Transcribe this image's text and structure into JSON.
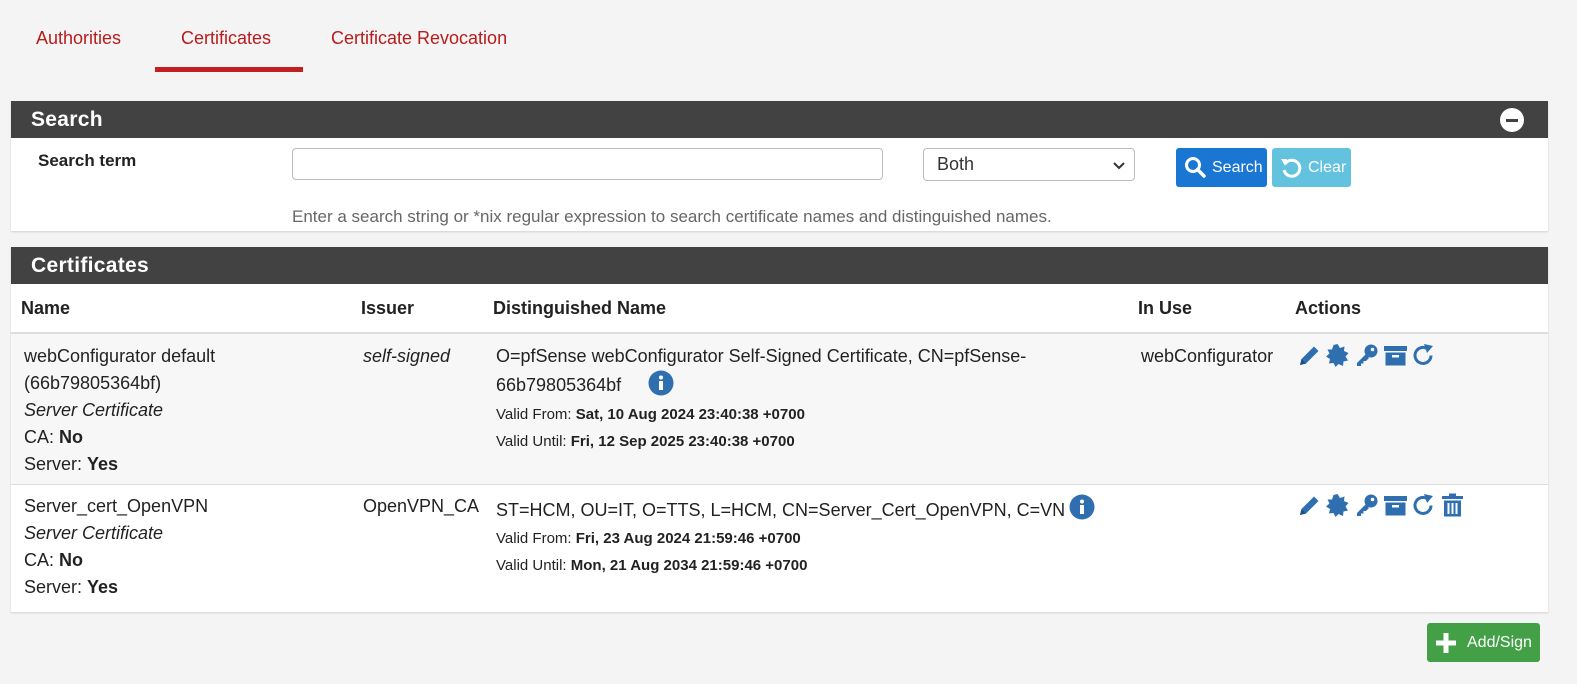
{
  "tabs": [
    {
      "label": "Authorities"
    },
    {
      "label": "Certificates"
    },
    {
      "label": "Certificate Revocation"
    }
  ],
  "search_panel": {
    "title": "Search",
    "term_label": "Search term",
    "term_value": "",
    "scope_selected": "Both",
    "search_button": "Search",
    "clear_button": "Clear",
    "help_text": "Enter a search string or *nix regular expression to search certificate names and distinguished names."
  },
  "certificates_panel": {
    "title": "Certificates",
    "columns": [
      "Name",
      "Issuer",
      "Distinguished Name",
      "In Use",
      "Actions"
    ],
    "rows": [
      {
        "name_line1": "webConfigurator default",
        "name_line2": "(66b79805364bf)",
        "type": "Server Certificate",
        "ca_label": "CA: ",
        "ca_value": "No",
        "server_label": "Server: ",
        "server_value": "Yes",
        "issuer": "self-signed",
        "dn_line1": "O=pfSense webConfigurator Self-Signed Certificate, CN=pfSense-",
        "dn_line2": "66b79805364bf",
        "valid_from_label": "Valid From: ",
        "valid_from": "Sat, 10 Aug 2024 23:40:38 +0700",
        "valid_until_label": "Valid Until: ",
        "valid_until": "Fri, 12 Sep 2025 23:40:38 +0700",
        "in_use": "webConfigurator",
        "actions": [
          "pencil-icon",
          "certificate-icon",
          "key-icon",
          "archive-icon",
          "renew-icon"
        ]
      },
      {
        "name_line1": "Server_cert_OpenVPN",
        "type": "Server Certificate",
        "ca_label": "CA: ",
        "ca_value": "No",
        "server_label": "Server: ",
        "server_value": "Yes",
        "issuer": "OpenVPN_CA",
        "dn_line1": "ST=HCM, OU=IT, O=TTS, L=HCM, CN=Server_Cert_OpenVPN, C=VN",
        "valid_from_label": "Valid From: ",
        "valid_from": "Fri, 23 Aug 2024 21:59:46 +0700",
        "valid_until_label": "Valid Until: ",
        "valid_until": "Mon, 21 Aug 2034 21:59:46 +0700",
        "in_use": "",
        "actions": [
          "pencil-icon",
          "certificate-icon",
          "key-icon",
          "archive-icon",
          "renew-icon",
          "trash-icon"
        ]
      }
    ]
  },
  "add_button": "Add/Sign",
  "colors": {
    "tab_text": "#b71c1c",
    "tab_active_underline": "#c0201f",
    "panel_header": "#424242",
    "search_button": "#1976d2",
    "clear_button": "#5bc0de",
    "add_button": "#43a047",
    "action_icon": "#2f6fb0"
  }
}
